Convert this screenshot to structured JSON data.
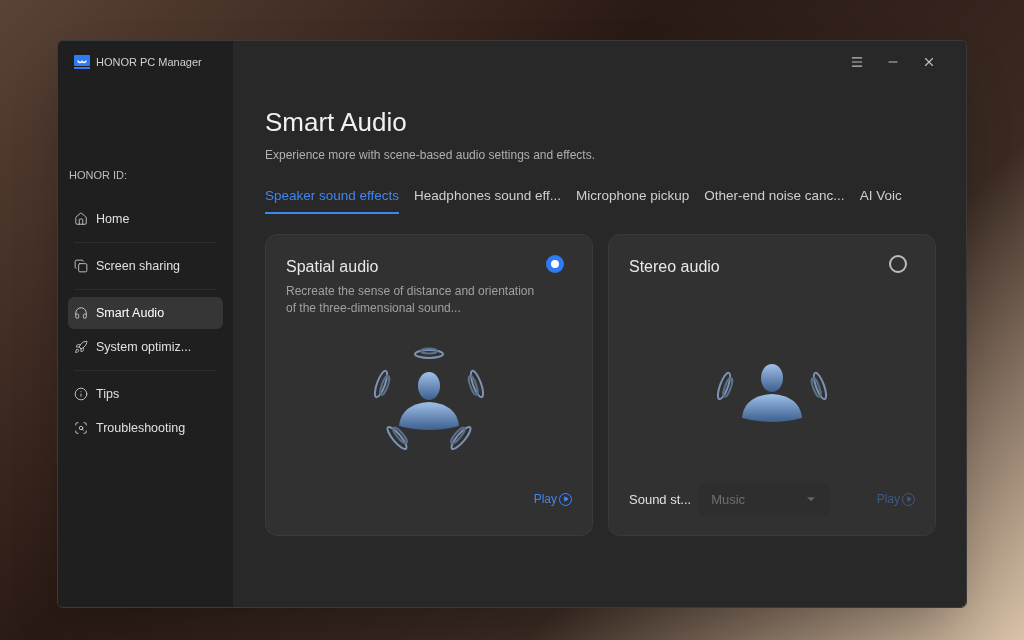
{
  "window": {
    "title": "HONOR PC Manager"
  },
  "sidebar": {
    "account_label": "HONOR ID:",
    "groups": [
      {
        "items": [
          {
            "label": "Home",
            "selected": false
          }
        ]
      },
      {
        "items": [
          {
            "label": "Screen sharing",
            "selected": false
          }
        ]
      },
      {
        "items": [
          {
            "label": "Smart Audio",
            "selected": true
          },
          {
            "label": "System optimiz...",
            "selected": false
          }
        ]
      },
      {
        "items": [
          {
            "label": "Tips",
            "selected": false
          },
          {
            "label": "Troubleshooting",
            "selected": false
          }
        ]
      }
    ]
  },
  "page": {
    "title": "Smart Audio",
    "subtitle": "Experience more with scene-based audio settings and effects."
  },
  "tabs": [
    {
      "label": "Speaker sound effects",
      "selected": true
    },
    {
      "label": "Headphones sound eff...",
      "selected": false
    },
    {
      "label": "Microphone pickup",
      "selected": false
    },
    {
      "label": "Other-end noise canc...",
      "selected": false
    },
    {
      "label": "AI Voic",
      "selected": false
    }
  ],
  "cards": [
    {
      "title": "Spatial audio",
      "kind": "spatial",
      "selected": true,
      "description": "Recreate the sense of distance and orientation of the three-dimensional sound...",
      "play": {
        "label": "Play",
        "disabled": false
      }
    },
    {
      "title": "Stereo audio",
      "kind": "stereo",
      "selected": false,
      "sound_style": {
        "label": "Sound st...",
        "value": "Music",
        "disabled": true
      },
      "play": {
        "label": "Play",
        "disabled": true
      }
    }
  ]
}
